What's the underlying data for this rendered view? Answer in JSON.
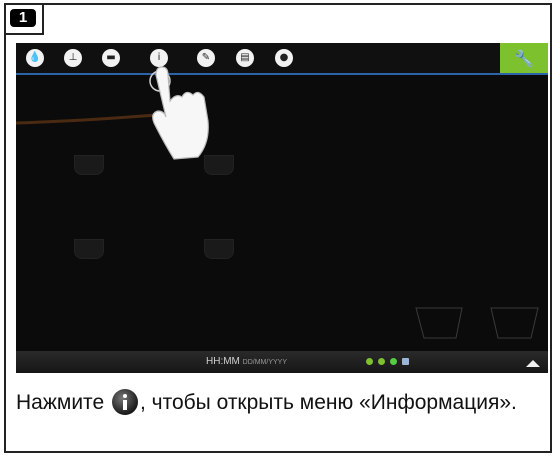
{
  "step": {
    "number": "1"
  },
  "screen": {
    "toolbar": {
      "icons": [
        "water-drop-icon",
        "clock-icon",
        "card-icon",
        "info-icon",
        "pencil-icon",
        "display-icon",
        "user-icon"
      ],
      "settings_icon": "wrench-icon",
      "accent_color": "#7dc12e",
      "bar_line_color": "#2d63a8"
    },
    "status_bar": {
      "time": "HH:MM",
      "date": "DD/MM/YYYY"
    }
  },
  "caption": {
    "before": "Нажмите ",
    "after": ", чтобы открыть меню «Информация»."
  }
}
